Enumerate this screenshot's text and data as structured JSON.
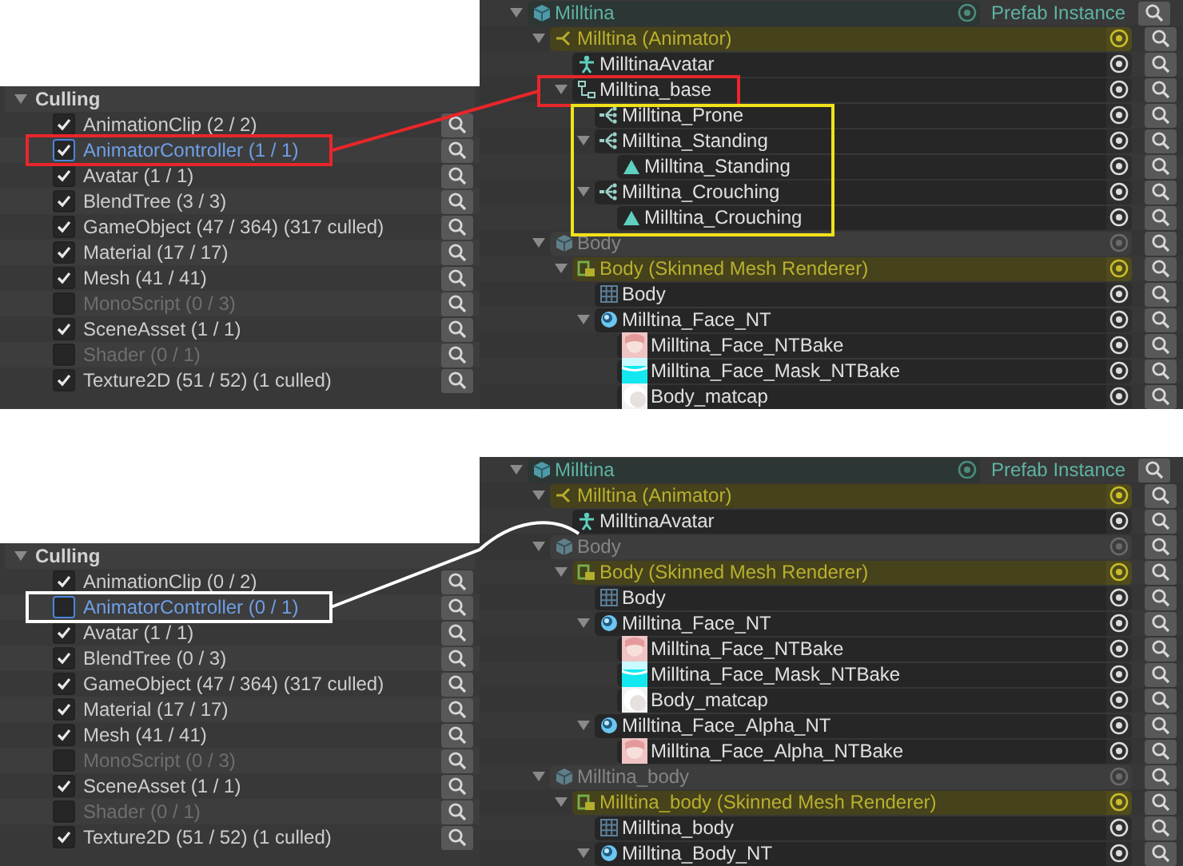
{
  "panels": [
    {
      "culling": {
        "title": "Culling",
        "expanded": true,
        "items": [
          {
            "label": "AnimationClip (2 / 2)",
            "checked": true,
            "disabled": false,
            "selected": false
          },
          {
            "label": "AnimatorController (1 / 1)",
            "checked": true,
            "disabled": false,
            "selected": true
          },
          {
            "label": "Avatar (1 / 1)",
            "checked": true,
            "disabled": false,
            "selected": false
          },
          {
            "label": "BlendTree (3 / 3)",
            "checked": true,
            "disabled": false,
            "selected": false
          },
          {
            "label": "GameObject (47 / 364) (317 culled)",
            "checked": true,
            "disabled": false,
            "selected": false
          },
          {
            "label": "Material (17 / 17)",
            "checked": true,
            "disabled": false,
            "selected": false
          },
          {
            "label": "Mesh (41 / 41)",
            "checked": true,
            "disabled": false,
            "selected": false
          },
          {
            "label": "MonoScript (0 / 3)",
            "checked": false,
            "disabled": true,
            "selected": false
          },
          {
            "label": "SceneAsset (1 / 1)",
            "checked": true,
            "disabled": false,
            "selected": false
          },
          {
            "label": "Shader (0 / 1)",
            "checked": false,
            "disabled": true,
            "selected": false
          },
          {
            "label": "Texture2D (51 / 52) (1 culled)",
            "checked": true,
            "disabled": false,
            "selected": false
          }
        ]
      },
      "hierarchy": {
        "rows": [
          {
            "label": "Milltina",
            "kind": "prefab",
            "badge": "Prefab Instance",
            "expanded": true,
            "children": [
              {
                "label": "Milltina (Animator)",
                "kind": "animator",
                "expanded": true,
                "children": [
                  {
                    "label": "MilltinaAvatar",
                    "kind": "avatar"
                  },
                  {
                    "label": "Milltina_base",
                    "kind": "statemachine",
                    "expanded": true,
                    "children": [
                      {
                        "label": "Milltina_Prone",
                        "kind": "blendtree"
                      },
                      {
                        "label": "Milltina_Standing",
                        "kind": "blendtree",
                        "expanded": true,
                        "children": [
                          {
                            "label": "Milltina_Standing",
                            "kind": "clip"
                          }
                        ]
                      },
                      {
                        "label": "Milltina_Crouching",
                        "kind": "blendtree",
                        "expanded": true,
                        "children": [
                          {
                            "label": "Milltina_Crouching",
                            "kind": "clip"
                          }
                        ]
                      }
                    ]
                  }
                ]
              },
              {
                "label": "Body",
                "kind": "gameobject",
                "expanded": true,
                "children": [
                  {
                    "label": "Body (Skinned Mesh Renderer)",
                    "kind": "renderer",
                    "expanded": true,
                    "children": [
                      {
                        "label": "Body",
                        "kind": "mesh"
                      },
                      {
                        "label": "Milltina_Face_NT",
                        "kind": "material",
                        "expanded": true,
                        "children": [
                          {
                            "label": "Milltina_Face_NTBake",
                            "kind": "texture-face"
                          },
                          {
                            "label": "Milltina_Face_Mask_NTBake",
                            "kind": "texture-mask"
                          },
                          {
                            "label": "Body_matcap",
                            "kind": "texture-matcap"
                          }
                        ]
                      }
                    ]
                  }
                ]
              }
            ]
          }
        ]
      }
    },
    {
      "culling": {
        "title": "Culling",
        "expanded": true,
        "items": [
          {
            "label": "AnimationClip (0 / 2)",
            "checked": true,
            "disabled": false,
            "selected": false
          },
          {
            "label": "AnimatorController (0 / 1)",
            "checked": false,
            "disabled": false,
            "selected": true
          },
          {
            "label": "Avatar (1 / 1)",
            "checked": true,
            "disabled": false,
            "selected": false
          },
          {
            "label": "BlendTree (0 / 3)",
            "checked": true,
            "disabled": false,
            "selected": false
          },
          {
            "label": "GameObject (47 / 364) (317 culled)",
            "checked": true,
            "disabled": false,
            "selected": false
          },
          {
            "label": "Material (17 / 17)",
            "checked": true,
            "disabled": false,
            "selected": false
          },
          {
            "label": "Mesh (41 / 41)",
            "checked": true,
            "disabled": false,
            "selected": false
          },
          {
            "label": "MonoScript (0 / 3)",
            "checked": false,
            "disabled": true,
            "selected": false
          },
          {
            "label": "SceneAsset (1 / 1)",
            "checked": true,
            "disabled": false,
            "selected": false
          },
          {
            "label": "Shader (0 / 1)",
            "checked": false,
            "disabled": true,
            "selected": false
          },
          {
            "label": "Texture2D (51 / 52) (1 culled)",
            "checked": true,
            "disabled": false,
            "selected": false
          }
        ]
      },
      "hierarchy": {
        "rows": [
          {
            "label": "Milltina",
            "kind": "prefab",
            "badge": "Prefab Instance",
            "expanded": true,
            "children": [
              {
                "label": "Milltina (Animator)",
                "kind": "animator",
                "expanded": true,
                "children": [
                  {
                    "label": "MilltinaAvatar",
                    "kind": "avatar"
                  }
                ]
              },
              {
                "label": "Body",
                "kind": "gameobject",
                "expanded": true,
                "children": [
                  {
                    "label": "Body (Skinned Mesh Renderer)",
                    "kind": "renderer",
                    "expanded": true,
                    "children": [
                      {
                        "label": "Body",
                        "kind": "mesh"
                      },
                      {
                        "label": "Milltina_Face_NT",
                        "kind": "material",
                        "expanded": true,
                        "children": [
                          {
                            "label": "Milltina_Face_NTBake",
                            "kind": "texture-face"
                          },
                          {
                            "label": "Milltina_Face_Mask_NTBake",
                            "kind": "texture-mask"
                          },
                          {
                            "label": "Body_matcap",
                            "kind": "texture-matcap"
                          }
                        ]
                      },
                      {
                        "label": "Milltina_Face_Alpha_NT",
                        "kind": "material",
                        "expanded": true,
                        "children": [
                          {
                            "label": "Milltina_Face_Alpha_NTBake",
                            "kind": "texture-face"
                          }
                        ]
                      }
                    ]
                  }
                ]
              },
              {
                "label": "Milltina_body",
                "kind": "gameobject",
                "expanded": true,
                "children": [
                  {
                    "label": "Milltina_body (Skinned Mesh Renderer)",
                    "kind": "renderer",
                    "expanded": true,
                    "children": [
                      {
                        "label": "Milltina_body",
                        "kind": "mesh"
                      },
                      {
                        "label": "Milltina_Body_NT",
                        "kind": "material",
                        "expanded": true
                      }
                    ]
                  }
                ]
              }
            ]
          }
        ]
      }
    }
  ]
}
